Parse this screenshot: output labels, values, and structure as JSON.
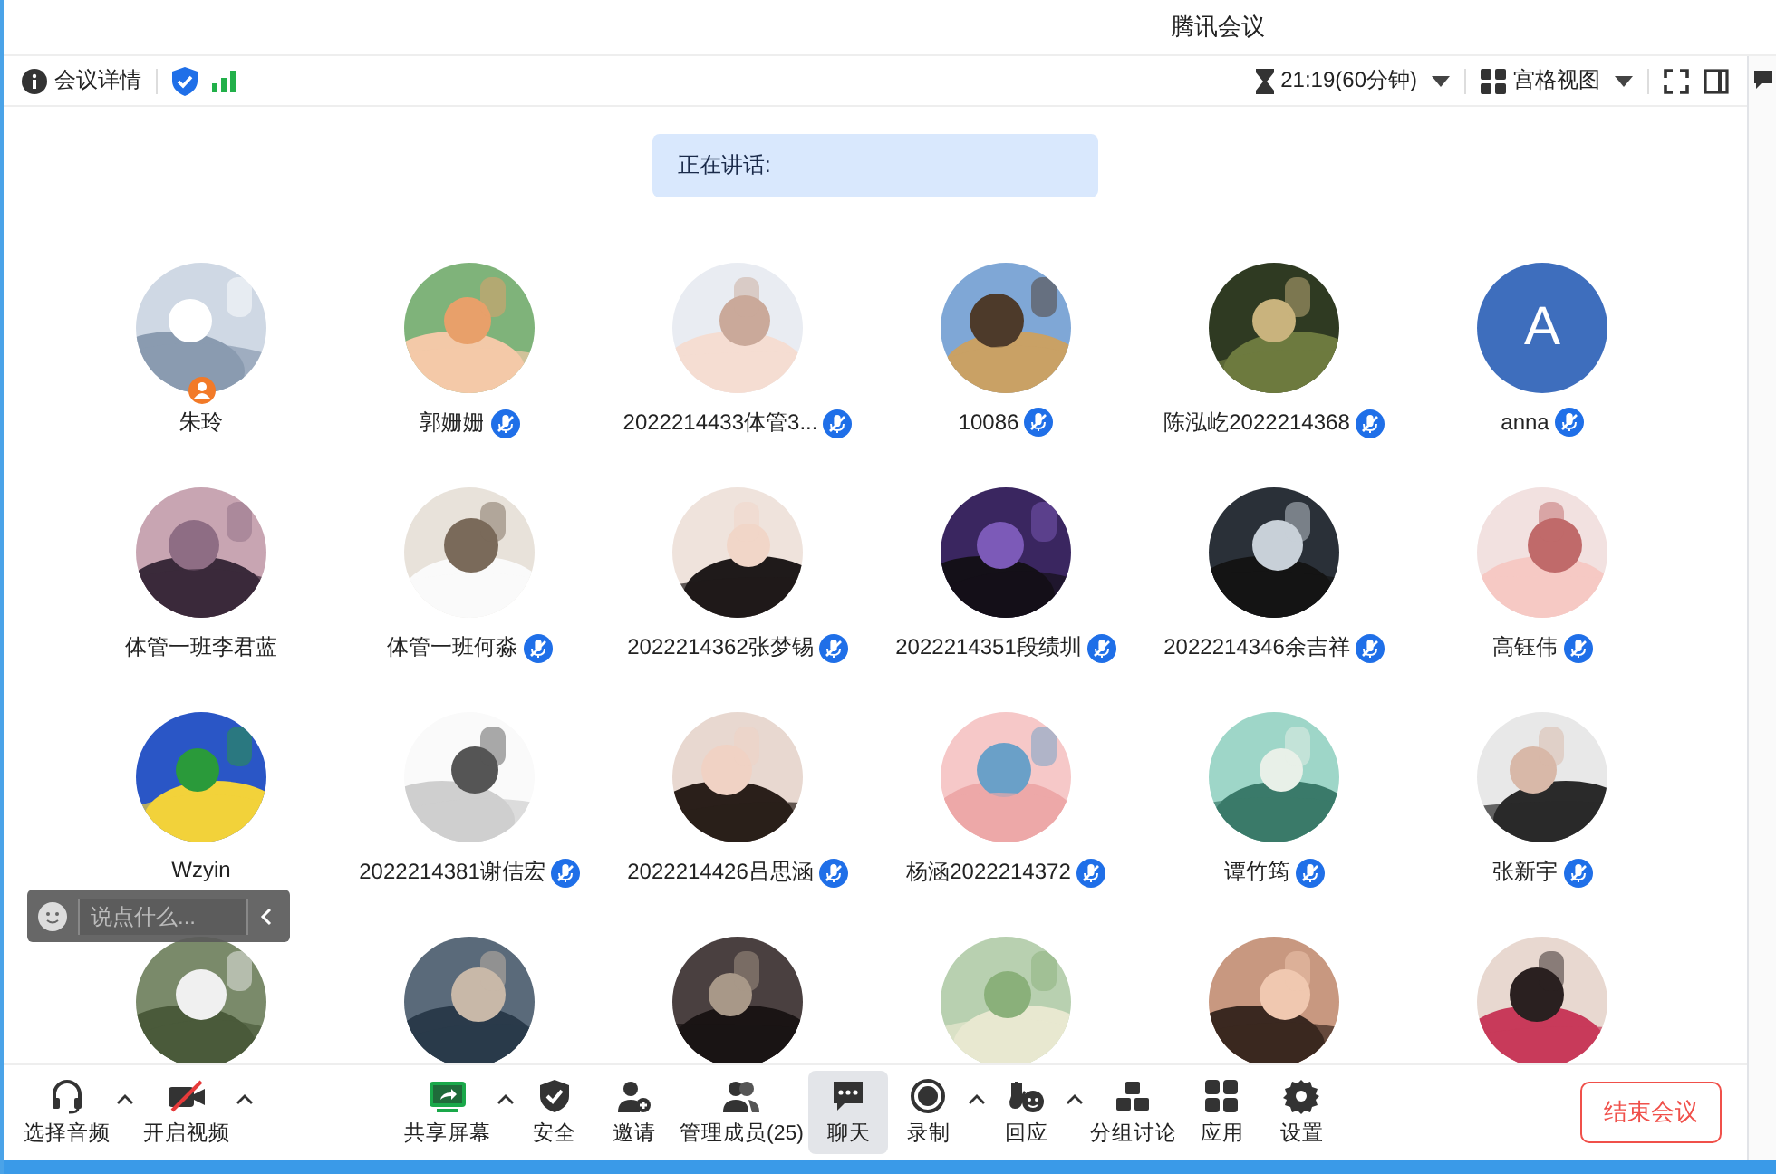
{
  "window": {
    "title": "腾讯会议"
  },
  "topbar": {
    "details": "会议详情",
    "timer": "21:19(60分钟)",
    "view": "宫格视图"
  },
  "speaking": {
    "label": "正在讲话:"
  },
  "participants": [
    {
      "name": "朱玲",
      "avatar": {
        "kind": "picture"
      },
      "muted": false,
      "host": true
    },
    {
      "name": "郭姗姗",
      "avatar": {
        "kind": "picture"
      },
      "muted": true,
      "host": false
    },
    {
      "name": "2022214433体管3...",
      "avatar": {
        "kind": "picture"
      },
      "muted": true,
      "host": false
    },
    {
      "name": "10086",
      "avatar": {
        "kind": "picture"
      },
      "muted": true,
      "host": false
    },
    {
      "name": "陈泓屹2022214368",
      "avatar": {
        "kind": "picture"
      },
      "muted": true,
      "host": false
    },
    {
      "name": "anna",
      "avatar": {
        "kind": "letter",
        "letter": "A"
      },
      "muted": true,
      "host": false
    },
    {
      "name": "体管一班李君蓝",
      "avatar": {
        "kind": "picture"
      },
      "muted": false,
      "host": false
    },
    {
      "name": "体管一班何淼",
      "avatar": {
        "kind": "picture"
      },
      "muted": true,
      "host": false
    },
    {
      "name": "2022214362张梦锡",
      "avatar": {
        "kind": "picture"
      },
      "muted": true,
      "host": false
    },
    {
      "name": "2022214351段绩圳",
      "avatar": {
        "kind": "picture"
      },
      "muted": true,
      "host": false
    },
    {
      "name": "2022214346余吉祥",
      "avatar": {
        "kind": "picture"
      },
      "muted": true,
      "host": false
    },
    {
      "name": "高钰伟",
      "avatar": {
        "kind": "picture"
      },
      "muted": true,
      "host": false
    },
    {
      "name": "Wzyin",
      "avatar": {
        "kind": "picture"
      },
      "muted": false,
      "host": false
    },
    {
      "name": "2022214381谢佶宏",
      "avatar": {
        "kind": "picture"
      },
      "muted": true,
      "host": false
    },
    {
      "name": "2022214426吕思涵",
      "avatar": {
        "kind": "picture"
      },
      "muted": true,
      "host": false
    },
    {
      "name": "杨涵2022214372",
      "avatar": {
        "kind": "picture"
      },
      "muted": true,
      "host": false
    },
    {
      "name": "谭竹筠",
      "avatar": {
        "kind": "picture"
      },
      "muted": true,
      "host": false
    },
    {
      "name": "张新宇",
      "avatar": {
        "kind": "picture"
      },
      "muted": true,
      "host": false
    },
    {
      "avatar": {
        "kind": "picture"
      }
    },
    {
      "avatar": {
        "kind": "picture"
      }
    },
    {
      "avatar": {
        "kind": "picture"
      }
    },
    {
      "avatar": {
        "kind": "picture"
      }
    },
    {
      "avatar": {
        "kind": "picture"
      }
    },
    {
      "avatar": {
        "kind": "picture"
      }
    }
  ],
  "chat_input": {
    "placeholder": "说点什么..."
  },
  "toolbar": [
    {
      "label": "选择音频",
      "caret": true,
      "selected": false
    },
    {
      "label": "开启视频",
      "caret": true,
      "selected": false
    },
    {
      "label": "共享屏幕",
      "caret": true,
      "selected": false
    },
    {
      "label": "安全",
      "caret": false,
      "selected": false
    },
    {
      "label": "邀请",
      "caret": false,
      "selected": false
    },
    {
      "label": "管理成员(25)",
      "caret": false,
      "selected": false
    },
    {
      "label": "聊天",
      "caret": false,
      "selected": true
    },
    {
      "label": "录制",
      "caret": true,
      "selected": false
    },
    {
      "label": "回应",
      "caret": true,
      "selected": false
    },
    {
      "label": "分组讨论",
      "caret": false,
      "selected": false
    },
    {
      "label": "应用",
      "caret": false,
      "selected": false
    },
    {
      "label": "设置",
      "caret": false,
      "selected": false
    }
  ],
  "end_button": "结束会议"
}
